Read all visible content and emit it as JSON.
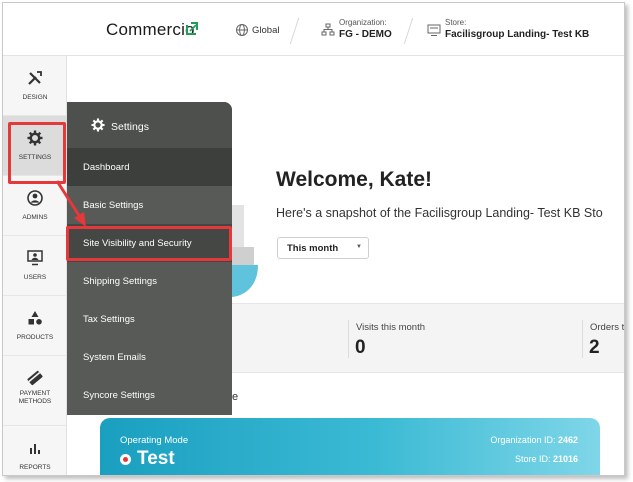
{
  "brand": {
    "logo_text": "Commercio"
  },
  "topbar": {
    "region": "Global",
    "organization_label": "Organization:",
    "organization_value": "FG - DEMO",
    "store_label": "Store:",
    "store_value": "Facilisgroup Landing- Test KB"
  },
  "rail": {
    "items": [
      {
        "label": "DESIGN",
        "icon": "design-icon"
      },
      {
        "label": "SETTINGS",
        "icon": "gear-icon"
      },
      {
        "label": "ADMINS",
        "icon": "admin-icon"
      },
      {
        "label": "USERS",
        "icon": "users-icon"
      },
      {
        "label": "PRODUCTS",
        "icon": "products-icon"
      },
      {
        "label": "PAYMENT METHODS",
        "icon": "payment-icon"
      },
      {
        "label": "REPORTS",
        "icon": "reports-icon"
      }
    ]
  },
  "settings_menu": {
    "title": "Settings",
    "items": [
      "Dashboard",
      "Basic Settings",
      "Site Visibility and Security",
      "Shipping Settings",
      "Tax Settings",
      "System Emails",
      "Syncore Settings"
    ]
  },
  "main": {
    "welcome": "Welcome, Kate!",
    "snapshot": "Here's a snapshot of the Facilisgroup Landing- Test KB Sto",
    "period_select": "This month",
    "stats": [
      {
        "label": "Visits this month",
        "value": "0"
      },
      {
        "label": "Orders t",
        "value": "2"
      }
    ],
    "stray_text": "e"
  },
  "operating_mode": {
    "label": "Operating Mode",
    "value": "Test",
    "org_id_label": "Organization ID:",
    "org_id": "2462",
    "store_id_label": "Store ID:",
    "store_id": "21016"
  },
  "colors": {
    "highlight": "#e5383b",
    "menu_bg": "#575a57",
    "logo_green": "#1f9e57",
    "mode_card": "#1a9fc0"
  }
}
